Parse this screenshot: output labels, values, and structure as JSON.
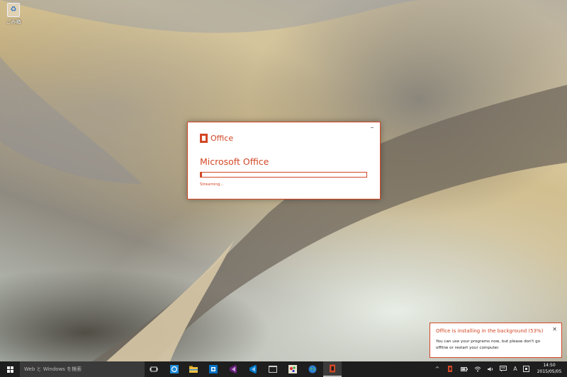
{
  "desktop": {
    "icons": [
      {
        "label": "ごみ箱",
        "icon": "recycle-bin-icon"
      }
    ]
  },
  "installer": {
    "brand": "Office",
    "title": "Microsoft Office",
    "status": "Streaming...",
    "progress": 0.01,
    "minimize_glyph": "–",
    "accent": "#d24726"
  },
  "notification": {
    "title": "Office is installing in the background (53%)",
    "body": "You can use your programs now, but please don't go offline or restart your computer.",
    "close_glyph": "✕"
  },
  "taskbar": {
    "search_placeholder": "Web と Windows を検索",
    "apps": [
      {
        "name": "task-view",
        "icon": "task-view-icon"
      },
      {
        "name": "browser",
        "icon": "browser-icon"
      },
      {
        "name": "file-explorer",
        "icon": "folder-icon"
      },
      {
        "name": "outlook",
        "icon": "outlook-icon"
      },
      {
        "name": "visual-studio",
        "icon": "visual-studio-icon"
      },
      {
        "name": "vs-code",
        "icon": "vs-code-icon"
      },
      {
        "name": "console",
        "icon": "console-icon"
      },
      {
        "name": "paint",
        "icon": "paint-icon"
      },
      {
        "name": "globe-app",
        "icon": "globe-icon"
      },
      {
        "name": "office",
        "icon": "office-icon"
      }
    ],
    "tray": {
      "chevron": "^",
      "ime": "A",
      "clock_time": "14:50",
      "clock_date": "2015/05/05"
    }
  }
}
